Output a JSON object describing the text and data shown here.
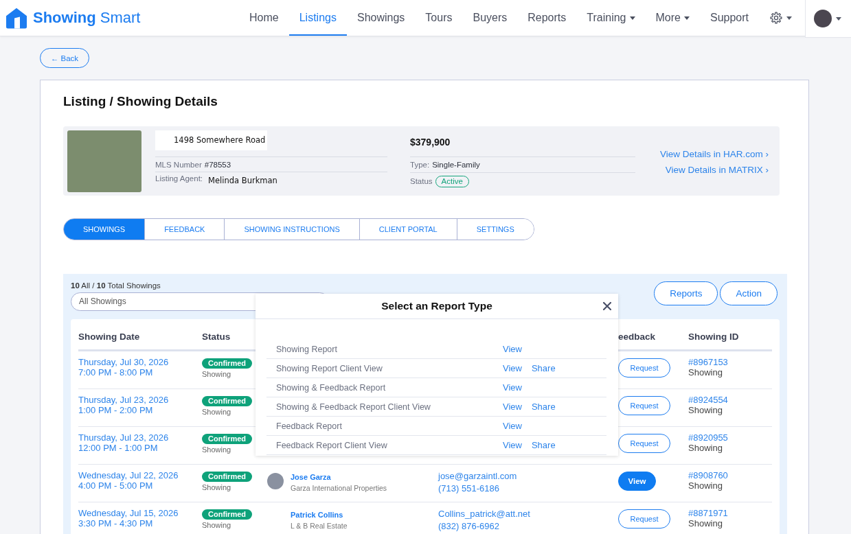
{
  "header": {
    "logo": "**Showing** Smart",
    "nav": [
      {
        "label": "Home",
        "selected": false,
        "dropdown": false
      },
      {
        "label": "Listings",
        "selected": true,
        "dropdown": false
      },
      {
        "label": "Showings",
        "selected": false,
        "dropdown": false
      },
      {
        "label": "Tours",
        "selected": false,
        "dropdown": false
      },
      {
        "label": "Buyers",
        "selected": false,
        "dropdown": false
      },
      {
        "label": "Reports",
        "selected": false,
        "dropdown": false
      },
      {
        "label": "Training",
        "selected": false,
        "dropdown": true
      },
      {
        "label": "More",
        "selected": false,
        "dropdown": true
      },
      {
        "label": "Support",
        "selected": false,
        "dropdown": false
      }
    ]
  },
  "back": {
    "label": "← Back"
  },
  "page_title": "Listing / Showing Details",
  "listing": {
    "address": "1498 Somewhere Road",
    "mls_label": "MLS Number",
    "mls_number": "#78553",
    "agent_label": "Listing Agent:",
    "agent": "Melinda Burkman",
    "price": "$379,900",
    "type_label": "Type:",
    "type": "Single-Family",
    "status_label": "Status",
    "status": "Active",
    "links": [
      "View Details in HAR.com ›",
      "View Details in MATRIX ›"
    ]
  },
  "tabs": [
    {
      "label": "SHOWINGS",
      "selected": true
    },
    {
      "label": "FEEDBACK",
      "selected": false
    },
    {
      "label": "SHOWING INSTRUCTIONS",
      "selected": false
    },
    {
      "label": "CLIENT PORTAL",
      "selected": false
    },
    {
      "label": "SETTINGS",
      "selected": false
    }
  ],
  "showings": {
    "summary": "**10** All / **10** Total Showings",
    "filter": {
      "value": "All Showings"
    },
    "buttons": [
      "Reports",
      "Action"
    ],
    "table": {
      "columns": {
        "date": "Showing Date",
        "status": "Status",
        "feedback": "eedback",
        "showing_id": "Showing ID"
      },
      "rows": [
        {
          "date": "Thursday, Jul 30, 2026",
          "time": "7:00 PM - 8:00 PM",
          "status": "Confirmed",
          "status_detail": "Showing",
          "feedback": {
            "label": "Request",
            "kind": "outline"
          },
          "showing_id": "#8967153",
          "showing_type": "Showing"
        },
        {
          "date": "Thursday, Jul 23, 2026",
          "time": "1:00 PM - 2:00 PM",
          "status": "Confirmed",
          "status_detail": "Showing",
          "feedback": {
            "label": "Request",
            "kind": "outline"
          },
          "showing_id": "#8924554",
          "showing_type": "Showing"
        },
        {
          "date": "Thursday, Jul 23, 2026",
          "time": "12:00 PM - 1:00 PM",
          "status": "Confirmed",
          "status_detail": "Showing",
          "feedback": {
            "label": "Request",
            "kind": "outline"
          },
          "showing_id": "#8920955",
          "showing_type": "Showing"
        },
        {
          "date": "Wednesday, Jul 22, 2026",
          "time": "4:00 PM - 5:00 PM",
          "status": "Confirmed",
          "status_detail": "Showing",
          "agent": {
            "name": "Jose Garza",
            "company": "Garza International Properties",
            "photo": true
          },
          "contact": {
            "email": "jose@garzaintl.com",
            "phone": "(713) 551-6186"
          },
          "feedback": {
            "label": "View",
            "kind": "solid"
          },
          "showing_id": "#8908760",
          "showing_type": "Showing"
        },
        {
          "date": "Wednesday, Jul 15, 2026",
          "time": "3:30 PM - 4:30 PM",
          "status": "Confirmed",
          "status_detail": "Showing",
          "agent": {
            "name": "Patrick Collins",
            "company": "L & B Real Estate",
            "photo": false
          },
          "contact": {
            "email": "Collins_patrick@att.net",
            "phone": "(832) 876-6962"
          },
          "feedback": {
            "label": "Request",
            "kind": "outline"
          },
          "showing_id": "#8871971",
          "showing_type": "Showing"
        }
      ]
    }
  },
  "report_dialog": {
    "title": "Select an Report Type",
    "rows": [
      {
        "label": "Showing Report",
        "actions": [
          "View"
        ]
      },
      {
        "label": "Showing Report Client View",
        "actions": [
          "View",
          "Share"
        ]
      },
      {
        "label": "Showing & Feedback Report",
        "actions": [
          "View"
        ]
      },
      {
        "label": "Showing & Feedback Report Client View",
        "actions": [
          "View",
          "Share"
        ]
      },
      {
        "label": "Feedback Report",
        "actions": [
          "View"
        ]
      },
      {
        "label": "Feedback Report Client View",
        "actions": [
          "View",
          "Share"
        ]
      }
    ]
  }
}
